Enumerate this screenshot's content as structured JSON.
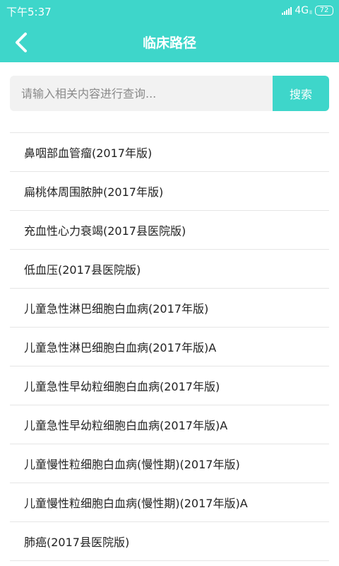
{
  "status": {
    "time": "下午5:37",
    "network": "4G",
    "network_sub": "ll",
    "battery": "72"
  },
  "header": {
    "title": "临床路径",
    "back_icon": "chevron-left-icon",
    "color": "#3ed6ca"
  },
  "search": {
    "placeholder": "请输入相关内容进行查询...",
    "button_label": "搜索"
  },
  "items": [
    "鼻咽部血管瘤(2017年版)",
    "扁桃体周围脓肿(2017年版)",
    "充血性心力衰竭(2017县医院版)",
    "低血压(2017县医院版)",
    "儿童急性淋巴细胞白血病(2017年版)",
    "儿童急性淋巴细胞白血病(2017年版)A",
    "儿童急性早幼粒细胞白血病(2017年版)",
    "儿童急性早幼粒细胞白血病(2017年版)A",
    "儿童慢性粒细胞白血病(慢性期)(2017年版)",
    "儿童慢性粒细胞白血病(慢性期)(2017年版)A",
    "肺癌(2017县医院版)"
  ]
}
